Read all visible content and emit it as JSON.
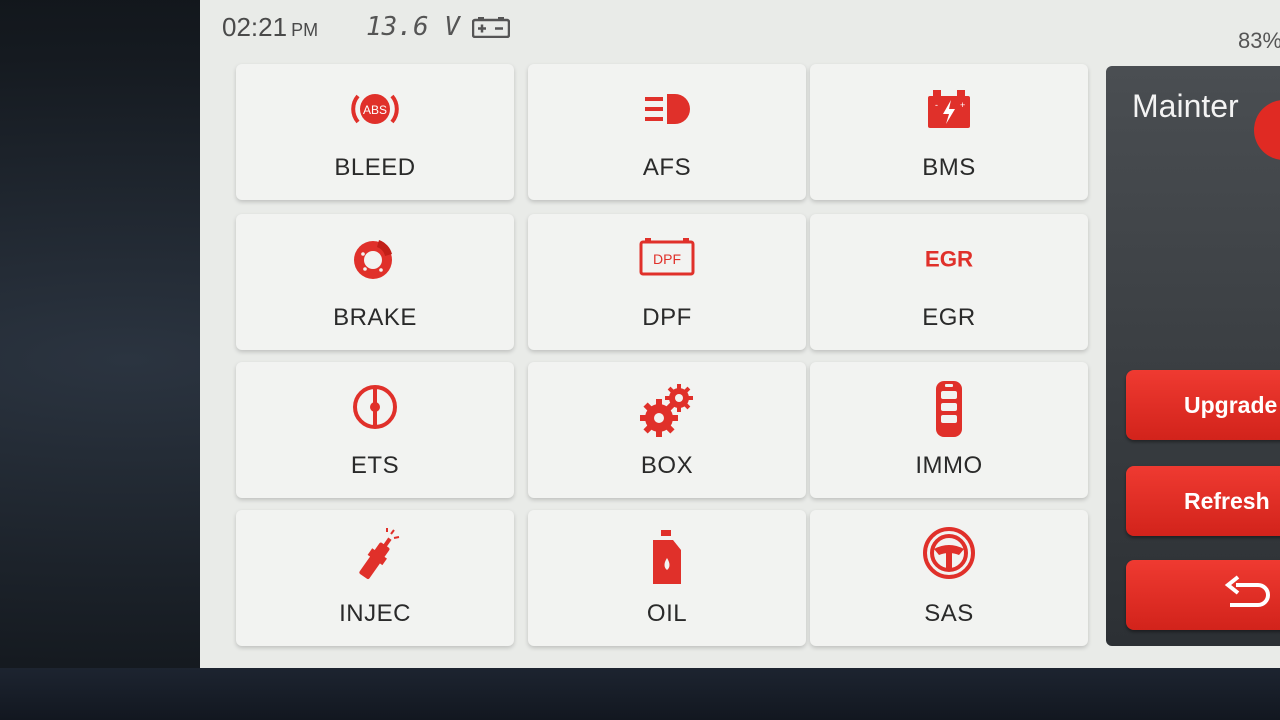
{
  "status": {
    "time": "02:21",
    "ampm": "PM",
    "voltage": "13.6 V",
    "battery_percent": "83%"
  },
  "tiles": [
    {
      "label": "BLEED",
      "icon": "abs-icon"
    },
    {
      "label": "AFS",
      "icon": "headlight-icon"
    },
    {
      "label": "BMS",
      "icon": "battery-icon"
    },
    {
      "label": "BRAKE",
      "icon": "brake-disc-icon"
    },
    {
      "label": "DPF",
      "icon": "dpf-icon",
      "icon_text": "DPF"
    },
    {
      "label": "EGR",
      "icon": "egr-icon",
      "icon_text": "EGR"
    },
    {
      "label": "ETS",
      "icon": "throttle-icon"
    },
    {
      "label": "BOX",
      "icon": "gears-icon"
    },
    {
      "label": "IMMO",
      "icon": "key-fob-icon"
    },
    {
      "label": "INJEC",
      "icon": "injector-icon"
    },
    {
      "label": "OIL",
      "icon": "oil-can-icon"
    },
    {
      "label": "SAS",
      "icon": "steering-wheel-icon"
    }
  ],
  "abs_text": "ABS",
  "side": {
    "title": "Mainter",
    "upgrade_label": "Upgrade",
    "refresh_label": "Refresh",
    "back_icon": "back-arrow-icon"
  },
  "colors": {
    "accent": "#e0302a",
    "tile_bg": "#f2f3f1",
    "panel_bg": "#3a3e42"
  }
}
